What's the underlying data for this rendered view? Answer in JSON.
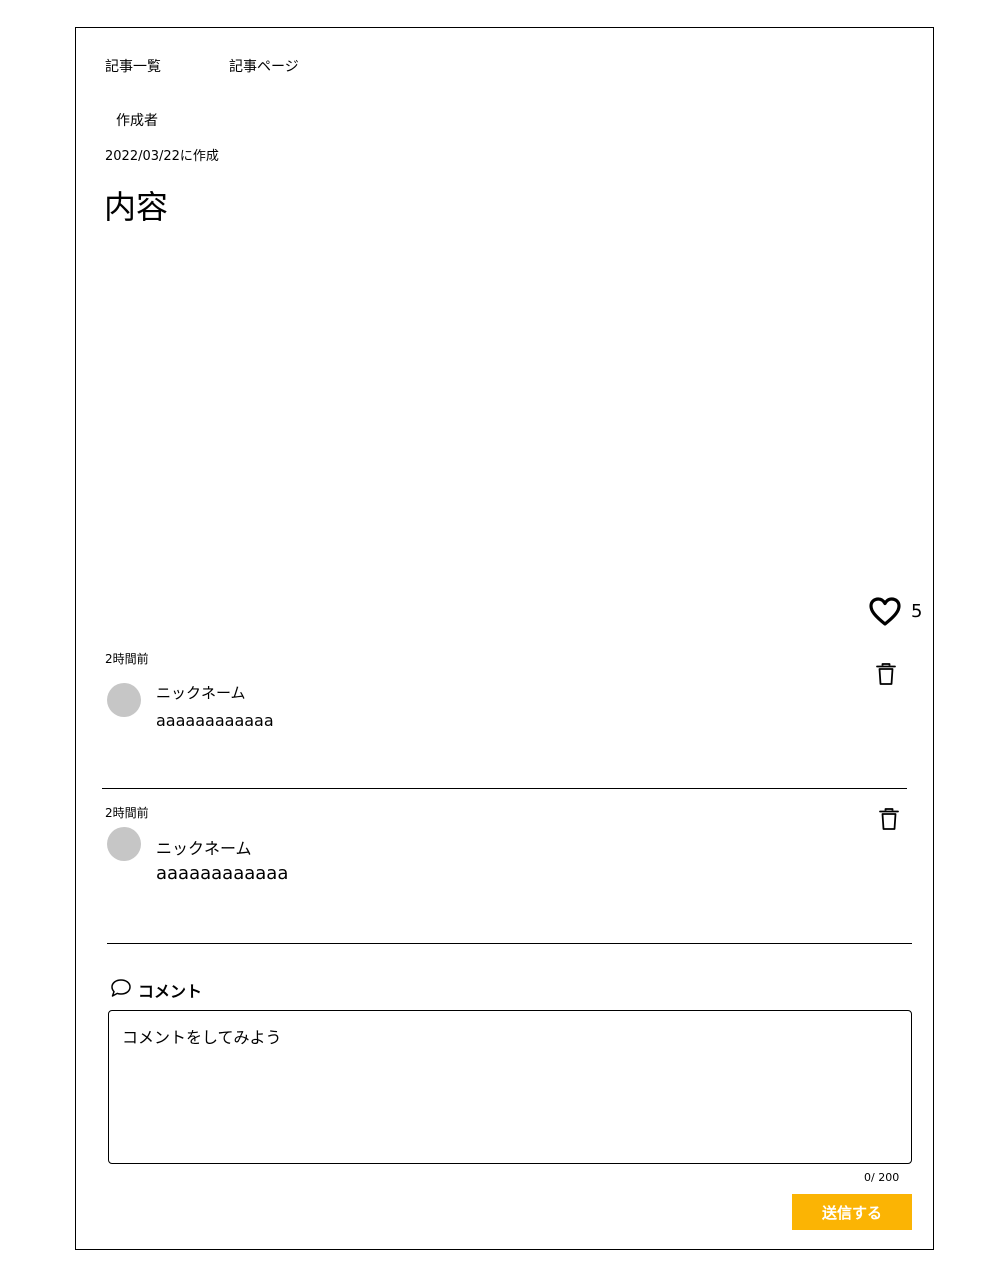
{
  "nav": {
    "article_list": "記事一覧",
    "article_page": "記事ページ"
  },
  "article": {
    "author": "作成者",
    "created": "2022/03/22に作成",
    "title": "内容",
    "likes": "5"
  },
  "comments": [
    {
      "time": "2時間前",
      "nickname": "ニックネーム",
      "text": "aaaaaaaaaaaa"
    },
    {
      "time": "2時間前",
      "nickname": "ニックネーム",
      "text": "aaaaaaaaaaaa"
    }
  ],
  "comment_form": {
    "heading": "コメント",
    "placeholder": "コメントをしてみよう",
    "counter": "0/ 200",
    "submit_label": "送信する"
  },
  "colors": {
    "accent": "#fbb404",
    "avatar": "#c6c6c6"
  },
  "icons": {
    "like": "heart-icon",
    "delete": "trash-icon",
    "comment": "speech-bubble-icon"
  }
}
